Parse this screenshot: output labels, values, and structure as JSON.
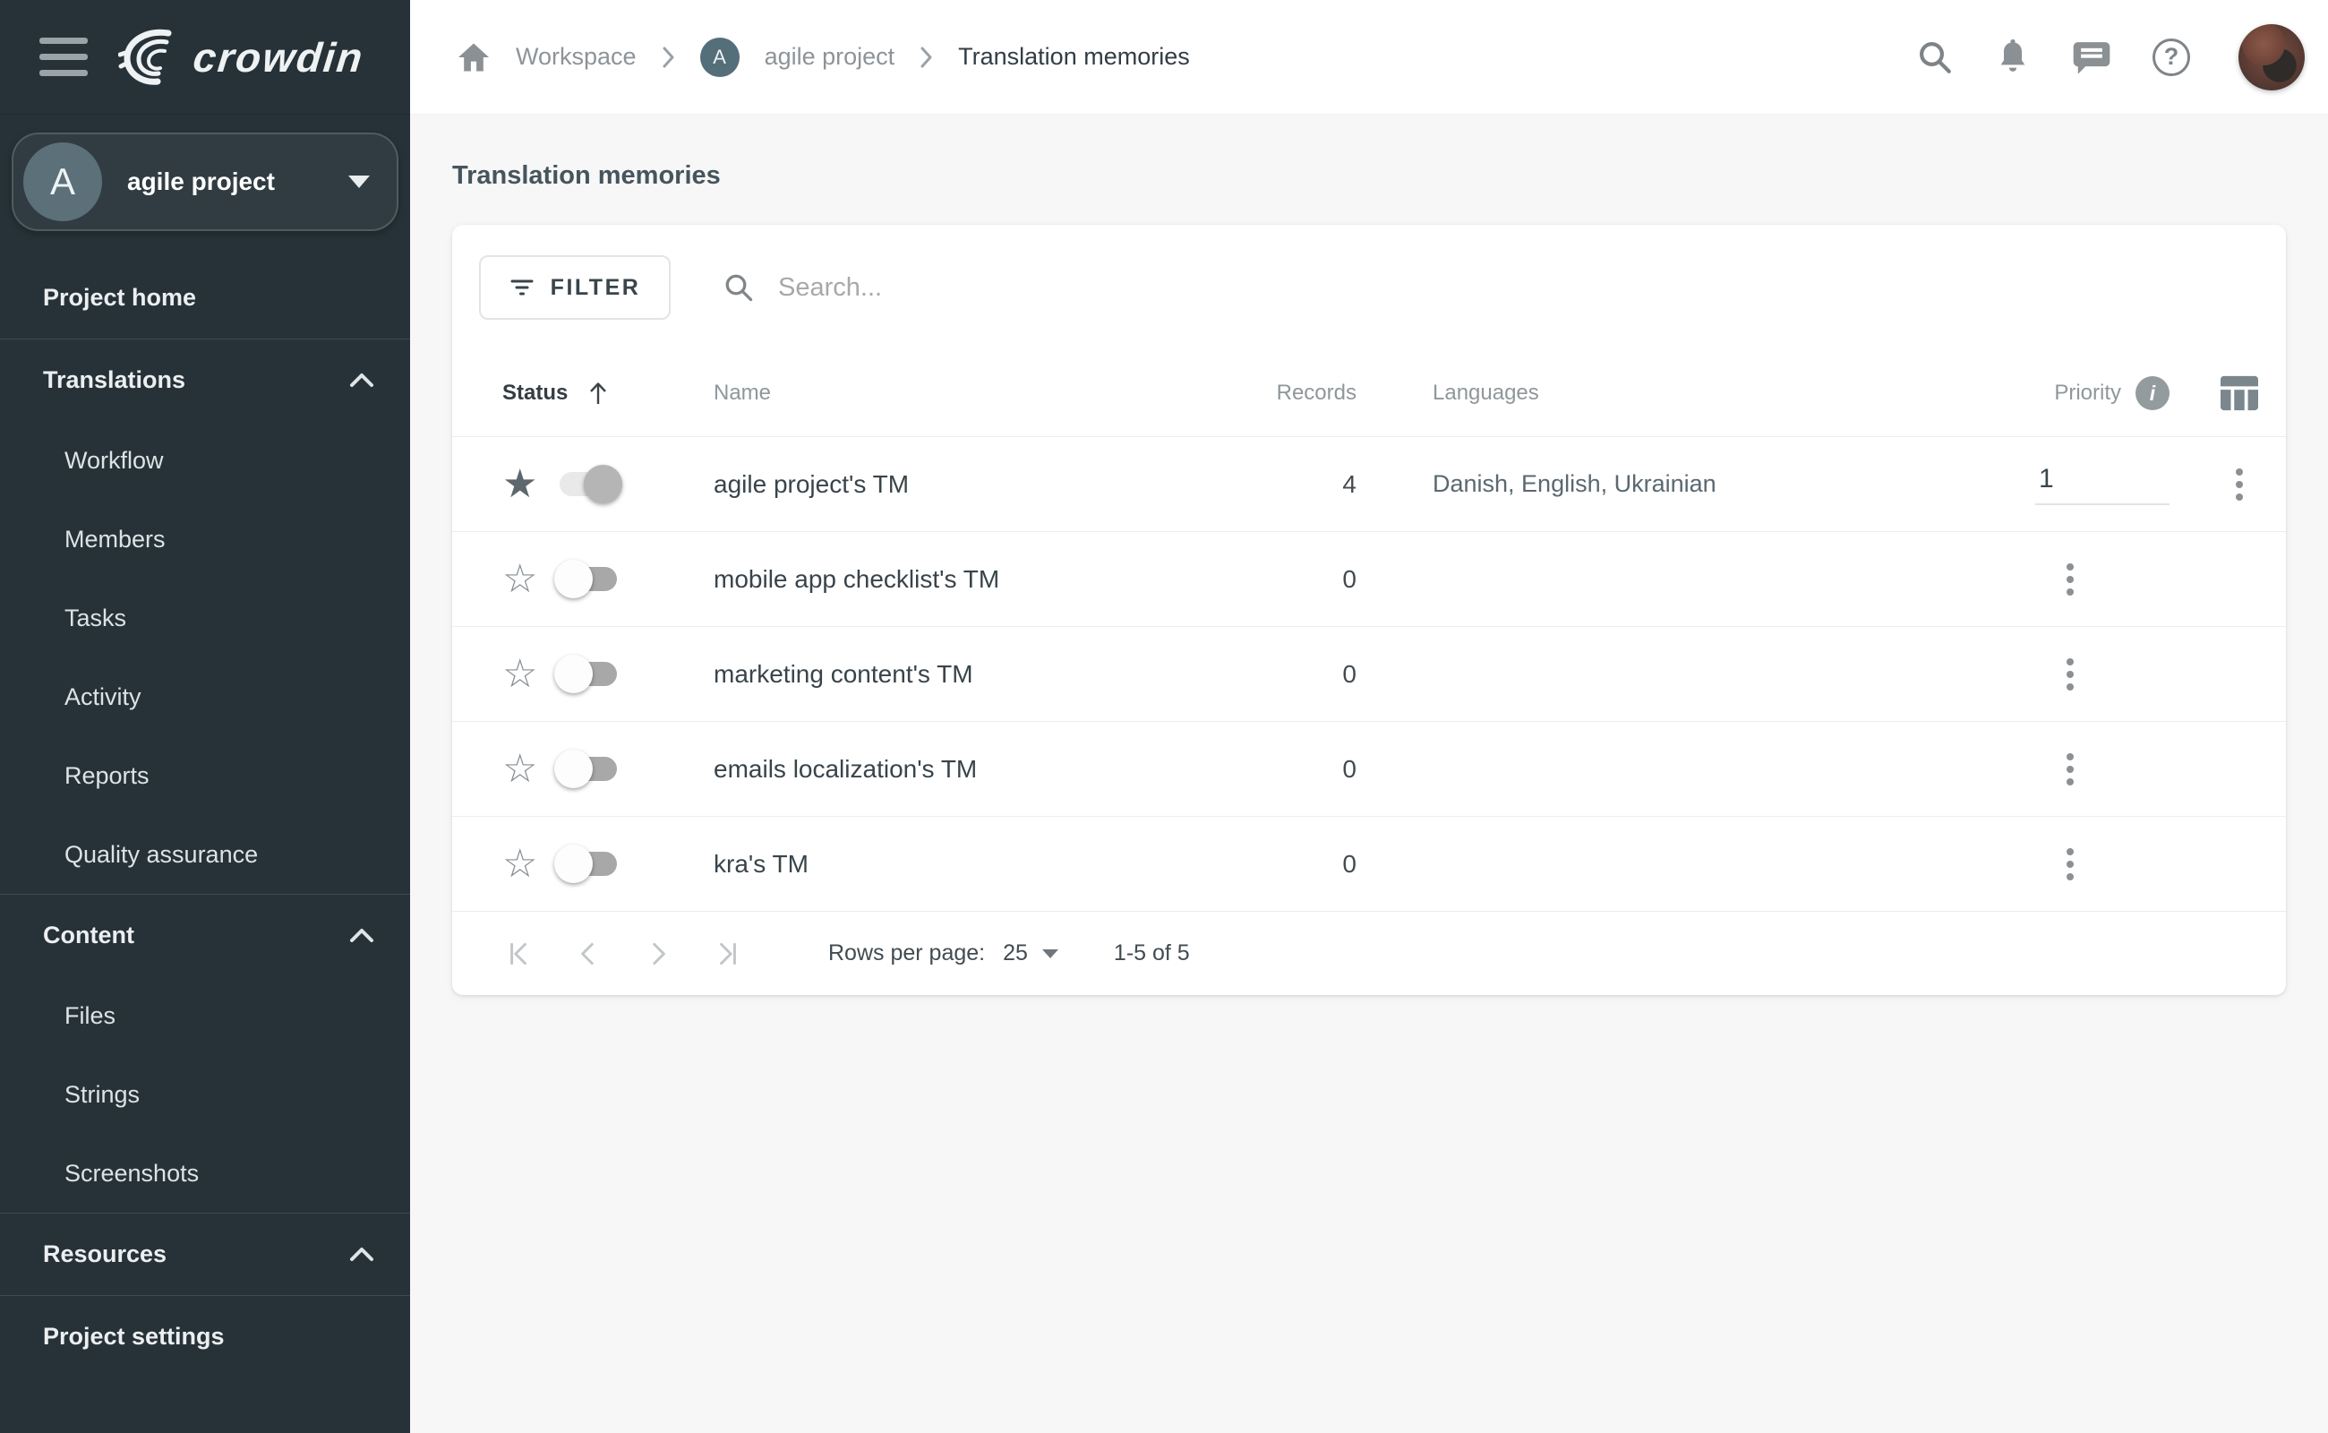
{
  "brand": {
    "name": "crowdin"
  },
  "colors": {
    "sidebar_bg": "#263238",
    "topbar_bg": "#ffffff",
    "page_bg": "#f7f7f7",
    "text_dark": "#39444a",
    "text_muted": "#8d9499"
  },
  "icons": {
    "menu": "hamburger",
    "logo_mark": "nested-crescents",
    "home": "house",
    "breadcrumb_separator": "chevron-right",
    "search": "magnifier",
    "notifications": "bell",
    "messages": "chat-bubble",
    "help": "question-circle",
    "project_dropdown": "caret-down",
    "section_collapse": "chevron-up",
    "filter": "filter-lines",
    "sort": "arrow-up",
    "info": "info-circle",
    "columns": "table-columns",
    "row_menu": "kebab-vertical",
    "favorite": "star",
    "pagination": [
      "first-page",
      "prev-page",
      "next-page",
      "last-page"
    ]
  },
  "topbar": {
    "breadcrumb": {
      "workspace": "Workspace",
      "project": "agile project",
      "project_initial": "A",
      "current": "Translation memories"
    }
  },
  "sidebar": {
    "project_initial": "A",
    "project_name": "agile project",
    "nav": [
      {
        "label": "Project home",
        "header": true
      },
      {
        "label": "Translations",
        "header": true,
        "chevron": true,
        "divider": true
      },
      {
        "label": "Workflow",
        "sub": true
      },
      {
        "label": "Members",
        "sub": true
      },
      {
        "label": "Tasks",
        "sub": true
      },
      {
        "label": "Activity",
        "sub": true
      },
      {
        "label": "Reports",
        "sub": true
      },
      {
        "label": "Quality assurance",
        "sub": true
      },
      {
        "label": "Content",
        "header": true,
        "chevron": true,
        "divider": true
      },
      {
        "label": "Files",
        "sub": true
      },
      {
        "label": "Strings",
        "sub": true
      },
      {
        "label": "Screenshots",
        "sub": true
      },
      {
        "label": "Resources",
        "header": true,
        "chevron": true,
        "divider": true
      },
      {
        "label": "Project settings",
        "header": true,
        "divider": true
      }
    ]
  },
  "main": {
    "title": "Translation memories",
    "toolbar": {
      "filter_label": "FILTER",
      "search_placeholder": "Search..."
    },
    "table": {
      "columns": {
        "status": "Status",
        "name": "Name",
        "records": "Records",
        "languages": "Languages",
        "priority": "Priority"
      },
      "rows": [
        {
          "name": "agile project's TM",
          "records": "4",
          "languages": "Danish, English, Ukrainian",
          "priority": "1",
          "starred": true,
          "enabled": true
        },
        {
          "name": "mobile app checklist's TM",
          "records": "0",
          "languages": "",
          "priority": "",
          "starred": false,
          "enabled": false
        },
        {
          "name": "marketing content's TM",
          "records": "0",
          "languages": "",
          "priority": "",
          "starred": false,
          "enabled": false
        },
        {
          "name": "emails localization's TM",
          "records": "0",
          "languages": "",
          "priority": "",
          "starred": false,
          "enabled": false
        },
        {
          "name": "kra's TM",
          "records": "0",
          "languages": "",
          "priority": "",
          "starred": false,
          "enabled": false
        }
      ],
      "pagination": {
        "rows_per_page_label": "Rows per page:",
        "rows_per_page": "25",
        "range": "1-5 of 5"
      }
    }
  }
}
